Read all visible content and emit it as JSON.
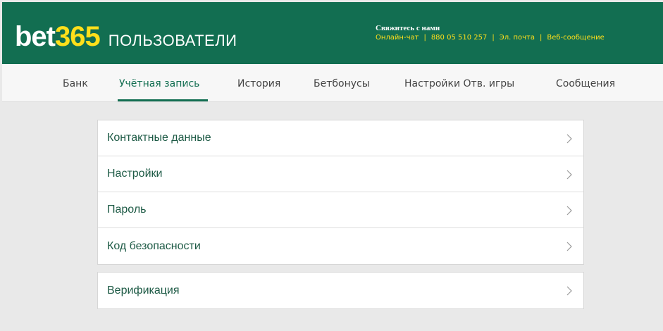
{
  "header": {
    "brand_bet": "bet",
    "brand_365": "365",
    "section": "ПОЛЬЗОВАТЕЛИ",
    "contact_title": "Свяжитесь с нами",
    "contact_links": [
      "Онлайн-чат",
      "880 05 510 257",
      "Эл. почта",
      "Веб-сообщение"
    ],
    "contact_separator": "|"
  },
  "nav": {
    "items": [
      "Банк",
      "Учётная запись",
      "История",
      "Бетбонусы",
      "Настройки Отв. игры",
      "Сообщения"
    ],
    "active_index": 1
  },
  "account_menu": {
    "items": [
      "Контактные данные",
      "Настройки",
      "Пароль",
      "Код безопасности"
    ]
  },
  "verification_menu": {
    "items": [
      "Верификация"
    ]
  },
  "icons": {
    "row_arrow": "chevron-right-icon"
  },
  "colors": {
    "brand_green": "#126e51",
    "brand_yellow": "#ffdf1b",
    "page_bg": "#e9e9e9"
  }
}
